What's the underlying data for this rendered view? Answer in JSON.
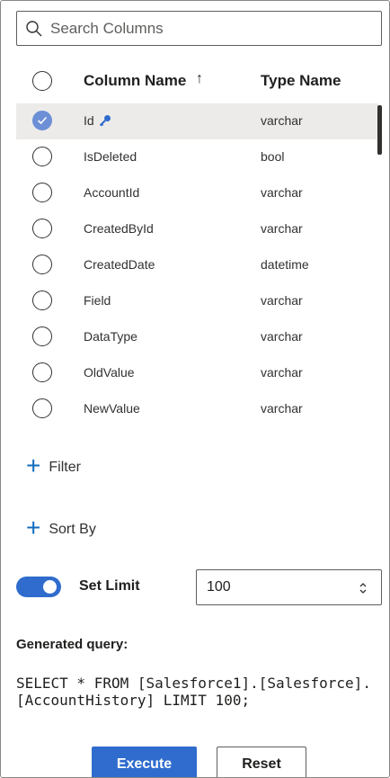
{
  "search": {
    "placeholder": "Search Columns"
  },
  "table": {
    "header": {
      "name": "Column Name",
      "sort_arrow": "↑",
      "type": "Type Name"
    },
    "rows": [
      {
        "name": "Id",
        "type": "varchar",
        "selected": true,
        "primary_key": true
      },
      {
        "name": "IsDeleted",
        "type": "bool"
      },
      {
        "name": "AccountId",
        "type": "varchar"
      },
      {
        "name": "CreatedById",
        "type": "varchar"
      },
      {
        "name": "CreatedDate",
        "type": "datetime"
      },
      {
        "name": "Field",
        "type": "varchar"
      },
      {
        "name": "DataType",
        "type": "varchar"
      },
      {
        "name": "OldValue",
        "type": "varchar"
      },
      {
        "name": "NewValue",
        "type": "varchar"
      }
    ]
  },
  "actions": {
    "filter": "Filter",
    "sort_by": "Sort By"
  },
  "limit": {
    "label": "Set Limit",
    "value": "100",
    "enabled": true
  },
  "query": {
    "label": "Generated query:",
    "text": "SELECT * FROM [Salesforce1].[Salesforce].[AccountHistory] LIMIT 100;"
  },
  "buttons": {
    "execute": "Execute",
    "reset": "Reset"
  },
  "colors": {
    "accent": "#2f6ccd",
    "checked": "#6c8fd6",
    "selected_row": "#edebe9"
  },
  "icons": {
    "search": "search-icon",
    "key": "key-icon",
    "check": "check-icon",
    "plus": "plus-icon",
    "spin": "spin-button-icon",
    "sort": "arrow-up-icon"
  }
}
